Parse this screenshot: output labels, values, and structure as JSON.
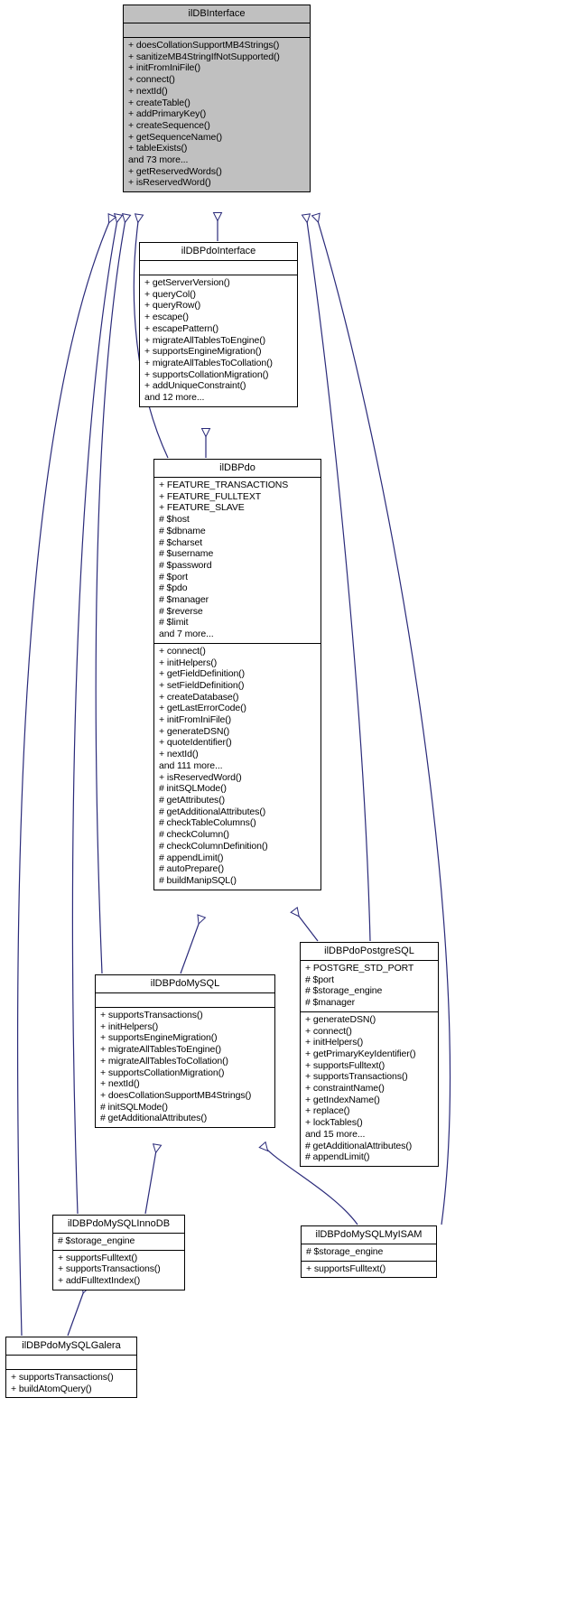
{
  "diagram": {
    "kind": "uml-inheritance-diagram",
    "title": "ilDBInterface inheritance diagram",
    "background_color": "#ffffff",
    "root_fill_color": "#c0c0c0",
    "box_fill_color": "#ffffff",
    "border_color": "#000000",
    "edge_color": "#2a2a7a",
    "classes": [
      {
        "id": "ilDBInterface",
        "name": "ilDBInterface",
        "highlighted": true,
        "attributes": [],
        "methods": [
          "+ doesCollationSupportMB4Strings()",
          "+ sanitizeMB4StringIfNotSupported()",
          "+ initFromIniFile()",
          "+ connect()",
          "+ nextId()",
          "+ createTable()",
          "+ addPrimaryKey()",
          "+ createSequence()",
          "+ getSequenceName()",
          "+ tableExists()",
          "and 73 more...",
          "+ getReservedWords()",
          "+ isReservedWord()"
        ]
      },
      {
        "id": "ilDBPdoInterface",
        "name": "ilDBPdoInterface",
        "highlighted": false,
        "attributes": [],
        "methods": [
          "+ getServerVersion()",
          "+ queryCol()",
          "+ queryRow()",
          "+ escape()",
          "+ escapePattern()",
          "+ migrateAllTablesToEngine()",
          "+ supportsEngineMigration()",
          "+ migrateAllTablesToCollation()",
          "+ supportsCollationMigration()",
          "+ addUniqueConstraint()",
          "and 12 more..."
        ]
      },
      {
        "id": "ilDBPdo",
        "name": "ilDBPdo",
        "highlighted": false,
        "attributes": [
          "+ FEATURE_TRANSACTIONS",
          "+ FEATURE_FULLTEXT",
          "+ FEATURE_SLAVE",
          "# $host",
          "# $dbname",
          "# $charset",
          "# $username",
          "# $password",
          "# $port",
          "# $pdo",
          "# $manager",
          "# $reverse",
          "# $limit",
          "and 7 more..."
        ],
        "methods": [
          "+ connect()",
          "+ initHelpers()",
          "+ getFieldDefinition()",
          "+ setFieldDefinition()",
          "+ createDatabase()",
          "+ getLastErrorCode()",
          "+ initFromIniFile()",
          "+ generateDSN()",
          "+ quoteIdentifier()",
          "+ nextId()",
          "and 111 more...",
          "+ isReservedWord()",
          "# initSQLMode()",
          "# getAttributes()",
          "# getAdditionalAttributes()",
          "# checkTableColumns()",
          "# checkColumn()",
          "# checkColumnDefinition()",
          "# appendLimit()",
          "# autoPrepare()",
          "# buildManipSQL()"
        ]
      },
      {
        "id": "ilDBPdoPostgreSQL",
        "name": "ilDBPdoPostgreSQL",
        "highlighted": false,
        "attributes": [
          "+ POSTGRE_STD_PORT",
          "# $port",
          "# $storage_engine",
          "# $manager"
        ],
        "methods": [
          "+ generateDSN()",
          "+ connect()",
          "+ initHelpers()",
          "+ getPrimaryKeyIdentifier()",
          "+ supportsFulltext()",
          "+ supportsTransactions()",
          "+ constraintName()",
          "+ getIndexName()",
          "+ replace()",
          "+ lockTables()",
          "and 15 more...",
          "# getAdditionalAttributes()",
          "# appendLimit()"
        ]
      },
      {
        "id": "ilDBPdoMySQL",
        "name": "ilDBPdoMySQL",
        "highlighted": false,
        "attributes": [],
        "methods": [
          "+ supportsTransactions()",
          "+ initHelpers()",
          "+ supportsEngineMigration()",
          "+ migrateAllTablesToEngine()",
          "+ migrateAllTablesToCollation()",
          "+ supportsCollationMigration()",
          "+ nextId()",
          "+ doesCollationSupportMB4Strings()",
          "# initSQLMode()",
          "# getAdditionalAttributes()"
        ]
      },
      {
        "id": "ilDBPdoMySQLInnoDB",
        "name": "ilDBPdoMySQLInnoDB",
        "highlighted": false,
        "attributes": [
          "# $storage_engine"
        ],
        "methods": [
          "+ supportsFulltext()",
          "+ supportsTransactions()",
          "+ addFulltextIndex()"
        ]
      },
      {
        "id": "ilDBPdoMySQLMyISAM",
        "name": "ilDBPdoMySQLMyISAM",
        "highlighted": false,
        "attributes": [
          "# $storage_engine"
        ],
        "methods": [
          "+ supportsFulltext()"
        ]
      },
      {
        "id": "ilDBPdoMySQLGalera",
        "name": "ilDBPdoMySQLGalera",
        "highlighted": false,
        "attributes": [],
        "methods": [
          "+ supportsTransactions()",
          "+ buildAtomQuery()"
        ]
      }
    ],
    "relations": [
      {
        "from": "ilDBPdoInterface",
        "to": "ilDBInterface",
        "type": "generalization"
      },
      {
        "from": "ilDBPdo",
        "to": "ilDBPdoInterface",
        "type": "generalization"
      },
      {
        "from": "ilDBPdo",
        "to": "ilDBInterface",
        "type": "generalization"
      },
      {
        "from": "ilDBPdoPostgreSQL",
        "to": "ilDBPdo",
        "type": "generalization"
      },
      {
        "from": "ilDBPdoPostgreSQL",
        "to": "ilDBInterface",
        "type": "generalization"
      },
      {
        "from": "ilDBPdoMySQL",
        "to": "ilDBPdo",
        "type": "generalization"
      },
      {
        "from": "ilDBPdoMySQL",
        "to": "ilDBInterface",
        "type": "generalization"
      },
      {
        "from": "ilDBPdoMySQLInnoDB",
        "to": "ilDBPdoMySQL",
        "type": "generalization"
      },
      {
        "from": "ilDBPdoMySQLInnoDB",
        "to": "ilDBInterface",
        "type": "generalization"
      },
      {
        "from": "ilDBPdoMySQLMyISAM",
        "to": "ilDBPdoMySQL",
        "type": "generalization"
      },
      {
        "from": "ilDBPdoMySQLMyISAM",
        "to": "ilDBInterface",
        "type": "generalization"
      },
      {
        "from": "ilDBPdoMySQLGalera",
        "to": "ilDBPdoMySQLInnoDB",
        "type": "generalization"
      },
      {
        "from": "ilDBPdoMySQLGalera",
        "to": "ilDBInterface",
        "type": "generalization"
      }
    ]
  }
}
